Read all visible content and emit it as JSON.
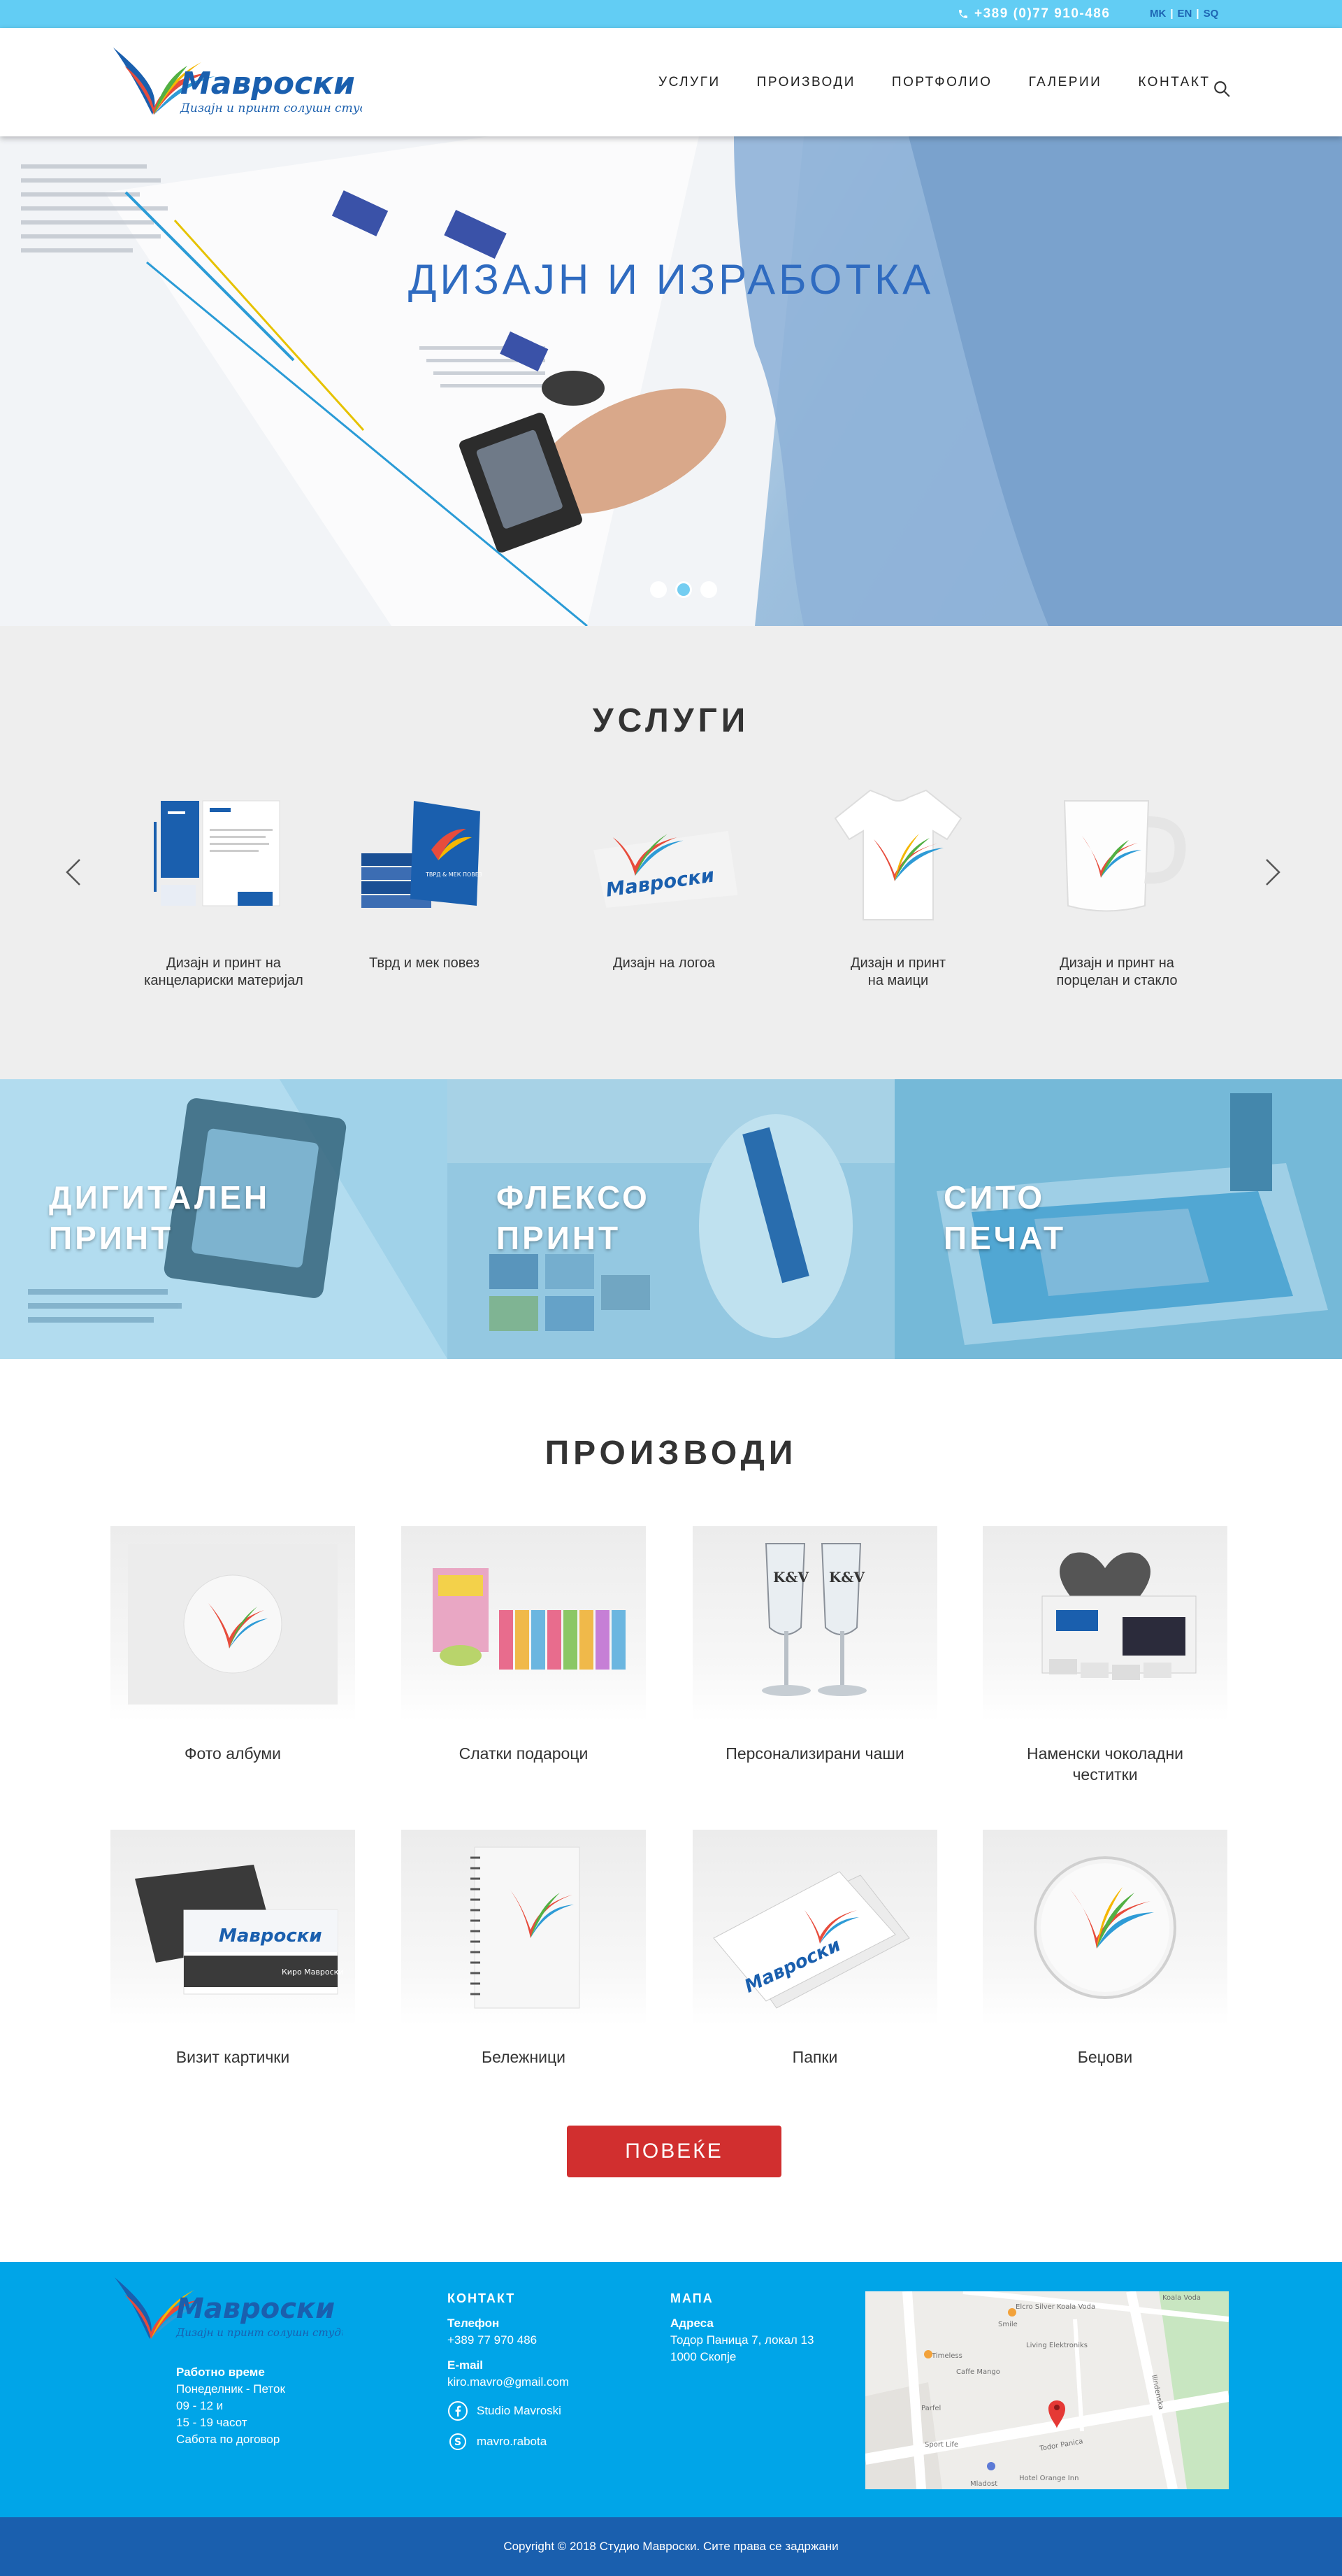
{
  "topbar": {
    "phone": "+389 (0)77 910-486",
    "langs": [
      "MK",
      "EN",
      "SQ"
    ],
    "lang_sep": "|"
  },
  "header": {
    "logo_name": "Мавроски",
    "logo_tagline": "Дизајн и принт солушн студио",
    "nav": [
      "УСЛУГИ",
      "ПРОИЗВОДИ",
      "ПОРТФОЛИО",
      "ГАЛЕРИИ",
      "КОНТАКТ"
    ],
    "search_icon": "search-icon"
  },
  "hero": {
    "title": "ДИЗАЈН И ИЗРАБОТКА",
    "slides": 3,
    "active_slide": 2
  },
  "services": {
    "title": "УСЛУГИ",
    "items": [
      {
        "caption": "Дизајн и принт на\nканцелариски материјал"
      },
      {
        "caption": "Тврд и мек повез"
      },
      {
        "caption": "Дизајн на логоа"
      },
      {
        "caption": "Дизајн и принт\nна маици"
      },
      {
        "caption": "Дизајн и принт на\nпорцелан и стакло"
      }
    ],
    "book_text": "ТВРД & МЕК ПОВЕЗ"
  },
  "print_types": [
    {
      "label": "ДИГИТАЛЕН\nПРИНТ"
    },
    {
      "label": "ФЛЕКСО\nПРИНТ"
    },
    {
      "label": "СИТО\nПЕЧАТ"
    }
  ],
  "products": {
    "title": "ПРОИЗВОДИ",
    "items": [
      {
        "caption": "Фото албуми"
      },
      {
        "caption": "Слатки подароци"
      },
      {
        "caption": "Персонализирани чаши"
      },
      {
        "caption": "Наменски чоколадни\nчеститки"
      },
      {
        "caption": "Визит картички"
      },
      {
        "caption": "Бележници"
      },
      {
        "caption": "Папки"
      },
      {
        "caption": "Беџови"
      }
    ],
    "glasses_text": "K&V",
    "card_name": "Киро Мавроски",
    "more_button": "ПОВЕЌЕ"
  },
  "footer": {
    "hours_title": "Работно време",
    "hours_lines": [
      "Понеделник - Петок",
      "09 - 12 и",
      "15 - 19 часот",
      "Сабота по договор"
    ],
    "contact_title": "КОНТАКТ",
    "phone_label": "Телефон",
    "phone": "+389 77 970 486",
    "email_label": "E-mail",
    "email": "kiro.mavro@gmail.com",
    "facebook": "Studio Mavroski",
    "skype": "mavro.rabota",
    "map_title": "МАПА",
    "address_label": "Адреса",
    "address_lines": [
      "Тодор Паница 7, локал 13",
      "1000 Скопје"
    ],
    "map_labels": [
      "Koala Voda",
      "Elcro Silver Koala Voda",
      "Smile",
      "Living Elektroniks",
      "Timeless",
      "Caffe Mango",
      "Parfel",
      "Sport Life",
      "Hotel Orange Inn",
      "Todor Panica",
      "Ilindenska",
      "Mladost"
    ]
  },
  "copyright": "Copyright © 2018 Студио Мавроски. Сите права се задржани"
}
